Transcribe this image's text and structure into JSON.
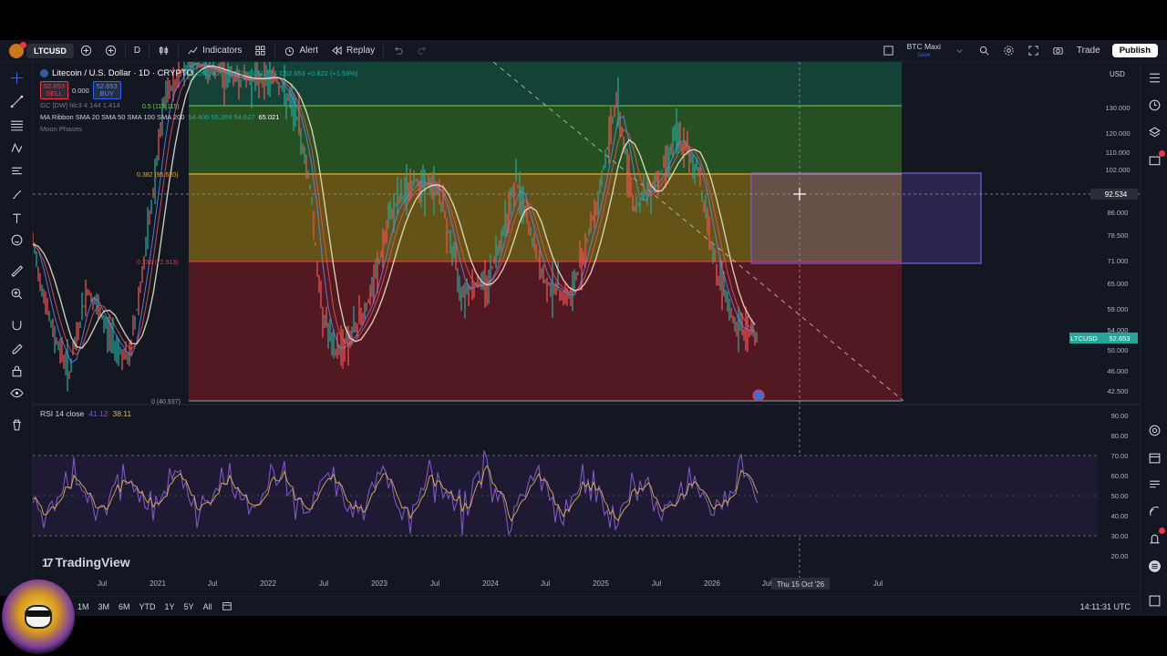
{
  "toolbar": {
    "symbol": "LTCUSD",
    "interval": "D",
    "indicators_label": "Indicators",
    "alert_label": "Alert",
    "replay_label": "Replay",
    "layout_name": "BTC Maxi",
    "layout_sub": "Save",
    "trade_label": "Trade",
    "publish_label": "Publish"
  },
  "legend": {
    "title": "Litecoin / U.S. Dollar · 1D · CRYPTO",
    "ohlc": "O51.400 H52.708 L51.771 C52.653 +0.822 (+1.59%)",
    "sell_price": "52.653",
    "sell_label": "SELL",
    "spread": "0.000",
    "buy_price": "52.653",
    "buy_label": "BUY",
    "gc_line": "GC [DW] hlc3 4 144 1.414",
    "ma_name": "MA Ribbon SMA 20 SMA 50 SMA 100 SMA 200",
    "ma_values": "54.400 55.269 54.627",
    "ma_last": "65.021",
    "moon_label": "Moon Phases"
  },
  "fib": {
    "l05": "0.5 (115.115)",
    "l0382": "0.382 (95.620)",
    "l0236": "0.236 (72.913)",
    "l0": "0 (40.937)"
  },
  "price_axis": {
    "currency": "USD",
    "ticks": [
      "130.000",
      "120.000",
      "110.000",
      "102.000",
      "92.534",
      "86.000",
      "78.500",
      "71.000",
      "65.000",
      "59.000",
      "54.000",
      "50.000",
      "46.000",
      "42.500"
    ],
    "crosshair_price": "92.534",
    "last_symbol": "LTCUSD",
    "last_price": "52.653"
  },
  "rsi": {
    "label": "RSI 14 close",
    "v1": "41.12",
    "v2": "38.11",
    "ticks": [
      "90.00",
      "80.00",
      "70.00",
      "60.00",
      "50.00",
      "40.00",
      "30.00",
      "20.00"
    ]
  },
  "time_axis": {
    "ticks": [
      "Jul",
      "2021",
      "Jul",
      "2022",
      "Jul",
      "2023",
      "Jul",
      "2024",
      "Jul",
      "2025",
      "Jul",
      "2026",
      "Jul",
      "Jul"
    ],
    "crosshair_date": "Thu 15 Oct '26"
  },
  "timeframes": [
    "1M",
    "3M",
    "6M",
    "YTD",
    "1Y",
    "5Y",
    "All"
  ],
  "clock": "14:11:31 UTC",
  "brand": "TradingView",
  "colors": {
    "bg": "#131722",
    "fib_green": "#1e7a4a",
    "fib_yellow": "#a89b1e",
    "fib_red": "#8b1a22",
    "rsi_line": "#7e57c2",
    "rsi_ma": "#e0b34e",
    "range_box": "#6a4cc9"
  }
}
